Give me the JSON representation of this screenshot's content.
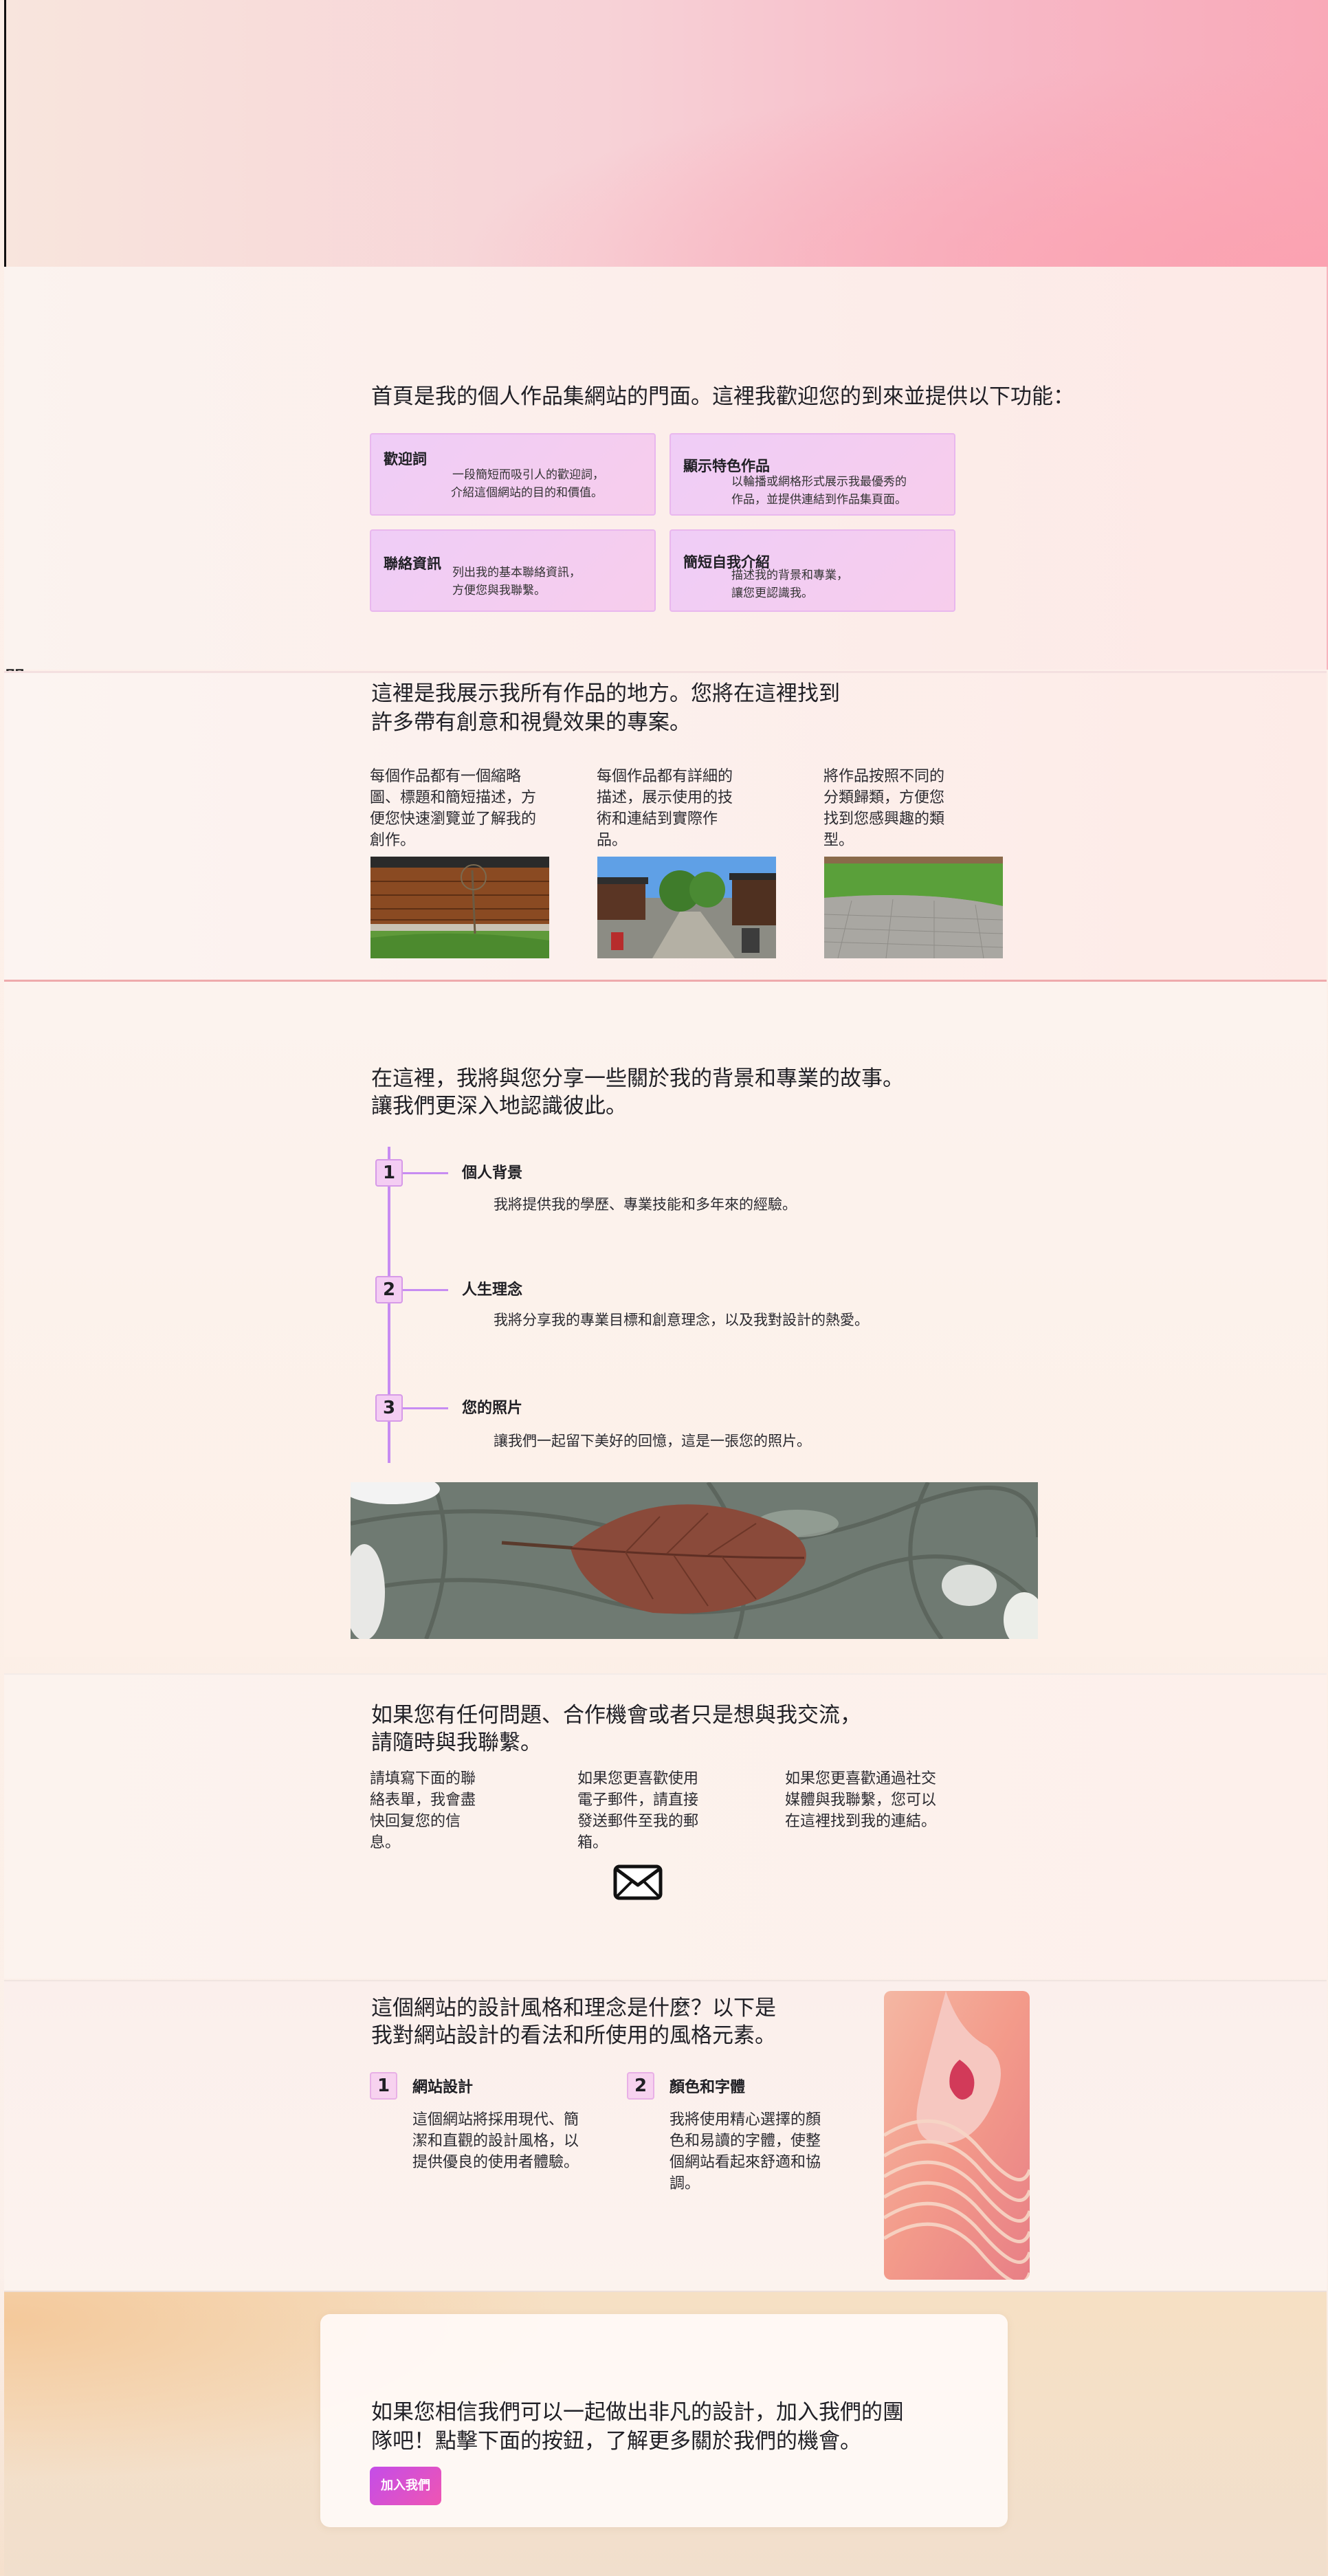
{
  "features": {
    "intro": "首頁是我的個人作品集網站的門面。這裡我歡迎您的到來並提供以下功能：",
    "cards": [
      {
        "title": "歡迎詞",
        "desc1": "一段簡短而吸引人的歡迎詞，",
        "desc2": "介紹這個網站的目的和價值。"
      },
      {
        "title": "顯示特色作品",
        "desc1": "以輪播或網格形式展示我最優秀的",
        "desc2": "作品，並提供連結到作品集頁面。"
      },
      {
        "title": "聯絡資訊",
        "desc1": "列出我的基本聯絡資訊，",
        "desc2": "方便您與我聯繫。"
      },
      {
        "title": "簡短自我介紹",
        "desc1": "描述我的背景和專業，",
        "desc2": "讓您更認識我。"
      }
    ]
  },
  "works": {
    "intro_line1": "這裡是我展示我所有作品的地方。您將在這裡找到",
    "intro_line2": "許多帶有創意和視覺效果的專案。",
    "columns": [
      {
        "lines": [
          "每個作品都有一個縮略",
          "圖、標題和簡短描述，方",
          "便您快速瀏覽並了解我的",
          "創作。"
        ]
      },
      {
        "lines": [
          "每個作品都有詳細的",
          "描述，展示使用的技",
          "術和連結到實際作",
          "品。"
        ]
      },
      {
        "lines": [
          "將作品按照不同的",
          "分類歸類，方便您",
          "找到您感興趣的類",
          "型。"
        ]
      }
    ]
  },
  "about": {
    "intro_line1": "在這裡，我將與您分享一些關於我的背景和專業的故事。",
    "intro_line2": "讓我們更深入地認識彼此。",
    "steps": [
      {
        "num": "1",
        "title": "個人背景",
        "desc": "我將提供我的學歷、專業技能和多年來的經驗。"
      },
      {
        "num": "2",
        "title": "人生理念",
        "desc": "我將分享我的專業目標和創意理念，以及我對設計的熱愛。"
      },
      {
        "num": "3",
        "title": "您的照片",
        "desc": "讓我們一起留下美好的回憶，這是一張您的照片。"
      }
    ]
  },
  "contact": {
    "intro_line1": "如果您有任何問題、合作機會或者只是想與我交流，",
    "intro_line2": "請隨時與我聯繫。",
    "columns": [
      {
        "lines": [
          "請填寫下面的聯",
          "絡表單，我會盡",
          "快回复您的信",
          "息。"
        ]
      },
      {
        "lines": [
          "如果您更喜歡使用",
          "電子郵件，請直接",
          "發送郵件至我的郵",
          "箱。"
        ]
      },
      {
        "lines": [
          "如果您更喜歡通過社交",
          "媒體與我聯繫，您可以",
          "在這裡找到我的連結。"
        ]
      }
    ],
    "mail_icon": "envelope-icon"
  },
  "design": {
    "intro_line1": "這個網站的設計風格和理念是什麼？以下是",
    "intro_line2": "我對網站設計的看法和所使用的風格元素。",
    "items": [
      {
        "num": "1",
        "title": "網站設計",
        "lines": [
          "這個網站將採用現代、簡",
          "潔和直觀的設計風格，以",
          "提供優良的使用者體驗。"
        ]
      },
      {
        "num": "2",
        "title": "顏色和字體",
        "lines": [
          "我將使用精心選擇的顏",
          "色和易讀的字體，使整",
          "個網站看起來舒適和協",
          "調。"
        ]
      }
    ]
  },
  "join": {
    "line1": "如果您相信我們可以一起做出非凡的設計，加入我們的團",
    "line2": "隊吧！點擊下面的按鈕，了解更多關於我們的機會。",
    "button": "加入我們"
  },
  "colors": {
    "accent": "#c44de8",
    "card_bg": "#efcdf7",
    "timeline": "#c78cf2"
  }
}
